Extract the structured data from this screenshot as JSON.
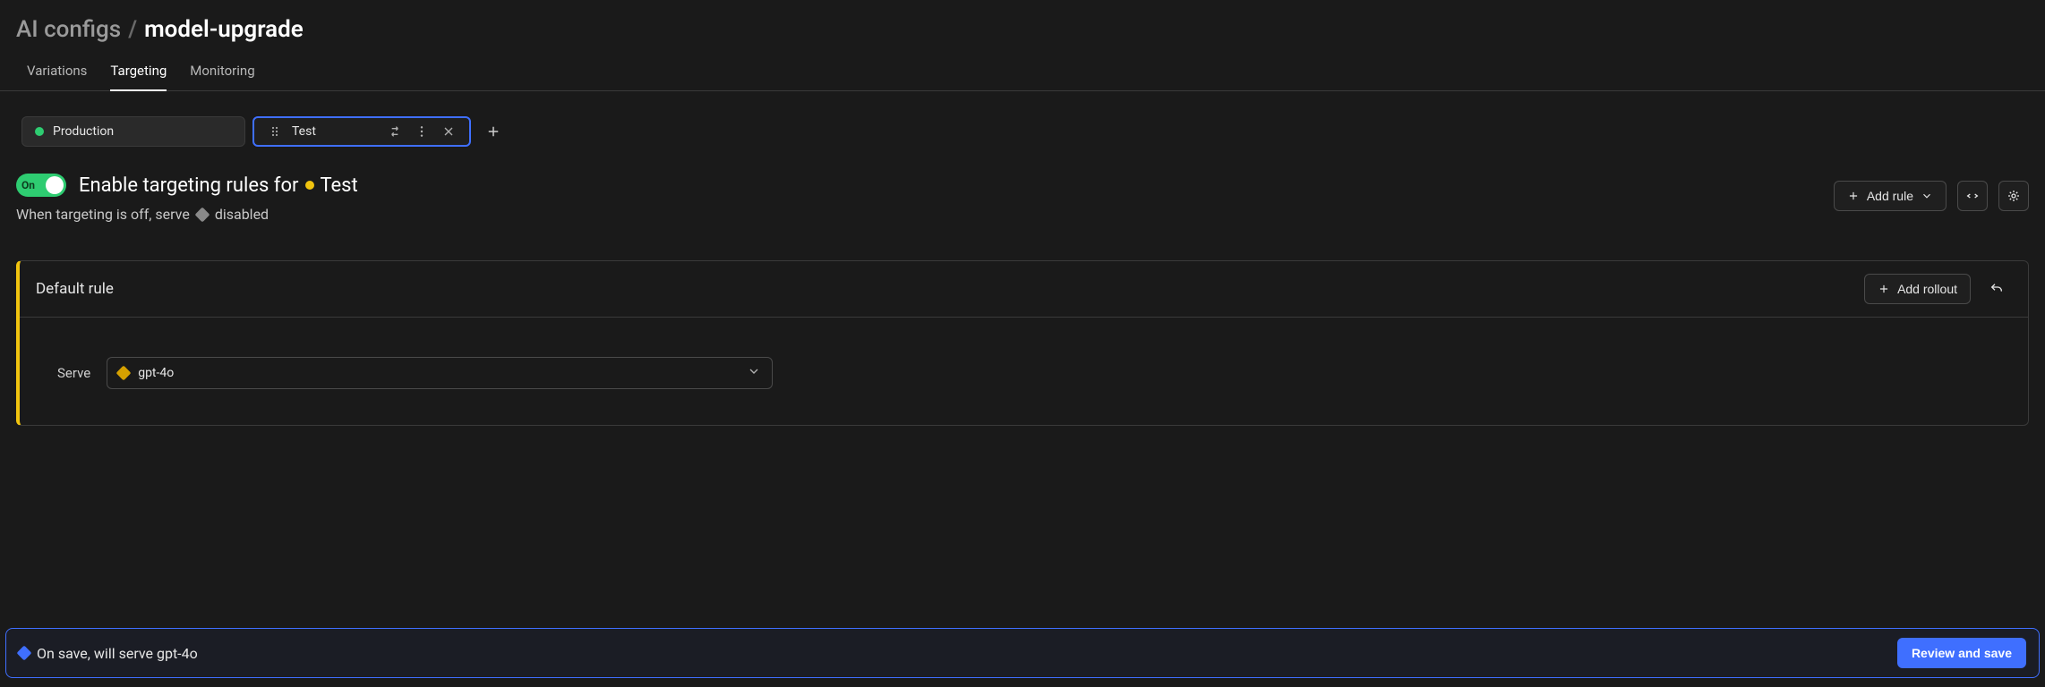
{
  "breadcrumb": {
    "parent": "AI configs",
    "current": "model-upgrade"
  },
  "tabs": [
    {
      "label": "Variations",
      "active": false
    },
    {
      "label": "Targeting",
      "active": true
    },
    {
      "label": "Monitoring",
      "active": false
    }
  ],
  "environments": {
    "production": {
      "label": "Production",
      "status_color": "#2ecc71"
    },
    "test": {
      "label": "Test",
      "status_color": "#f1c40f",
      "active": true
    }
  },
  "toggle": {
    "state_label": "On",
    "on": true
  },
  "enable_text_prefix": "Enable targeting rules for",
  "enable_env_name": "Test",
  "off_serve": {
    "prefix": "When targeting is off, serve",
    "variation": "disabled",
    "diamond_color": "#8a8a8a"
  },
  "actions": {
    "add_rule": "Add rule",
    "add_rollout": "Add rollout"
  },
  "default_rule": {
    "title": "Default rule",
    "serve_label": "Serve",
    "selected_variation": "gpt-4o",
    "diamond_color": "#d6a100"
  },
  "save_banner": {
    "message": "On save, will serve gpt-4o",
    "diamond_color": "#3f6fff",
    "button": "Review and save"
  },
  "icons": {
    "drag": "drag-handle-icon",
    "compare": "compare-icon",
    "more": "more-vertical-icon",
    "close": "close-icon",
    "plus": "plus-icon",
    "chevron_down": "chevron-down-icon",
    "code_collapse": "code-collapse-icon",
    "magic": "magic-icon",
    "undo": "undo-icon"
  }
}
